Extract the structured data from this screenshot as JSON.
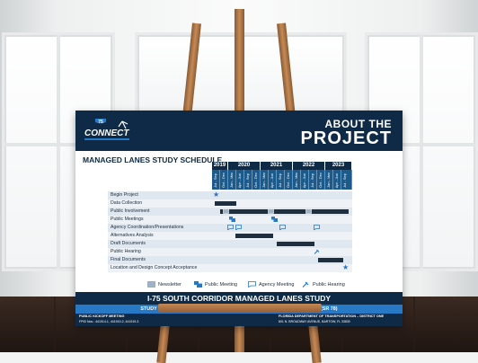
{
  "poster": {
    "logo_text": "CONNECT",
    "logo_number": "75",
    "heading_line1": "ABOUT THE",
    "heading_line2": "PROJECT",
    "schedule_title": "MANAGED LANES STUDY SCHEDULE",
    "years": [
      "2019",
      "2020",
      "2021",
      "2022",
      "2023"
    ],
    "quarters": [
      "Jul - Sep",
      "Oct - Dec",
      "Jan - Mar",
      "Apr - Jun",
      "Jul - Sep",
      "Oct - Dec",
      "Jan - Mar",
      "Apr - Jun",
      "Jul - Sep",
      "Oct - Dec",
      "Jan - Mar",
      "Apr - Jun",
      "Jul - Sep",
      "Oct - Dec",
      "Jan - Mar",
      "Apr - Jun",
      "Jul - Sep"
    ],
    "tasks": [
      "Begin Project",
      "Data Collection",
      "Public Involvement",
      "Public Meetings",
      "Agency Coordination/Presentations",
      "Alternatives Analysis",
      "Draft Documents",
      "Public Hearing",
      "Final Documents",
      "Location and Design Concept Acceptance"
    ],
    "legend": {
      "newsletter": "Newsletter",
      "public_meeting": "Public Meeting",
      "agency_meeting": "Agency Meeting",
      "public_hearing": "Public Hearing"
    },
    "study_title": "I-75 SOUTH CORRIDOR MANAGED LANES STUDY",
    "study_limits": "STUDY LIMITS: I-75 from east of Collier Boulevard (SR 951) to Bayshore Road (SR 78)",
    "footer_left_title": "PUBLIC KICKOFF MEETING",
    "footer_left_sub": "FPID Nos.: 441914-1, 441919-2, 441919-3",
    "footer_right_title": "FLORIDA DEPARTMENT OF TRANSPORTATION – DISTRICT ONE",
    "footer_right_sub": "801 N. BROADWAY AVENUE, BARTOW, FL 33830"
  },
  "colors": {
    "navy": "#0e2a46",
    "accent_blue": "#2778c5",
    "bar": "#1f2f3f",
    "easel_wood": "#b97e4b"
  }
}
